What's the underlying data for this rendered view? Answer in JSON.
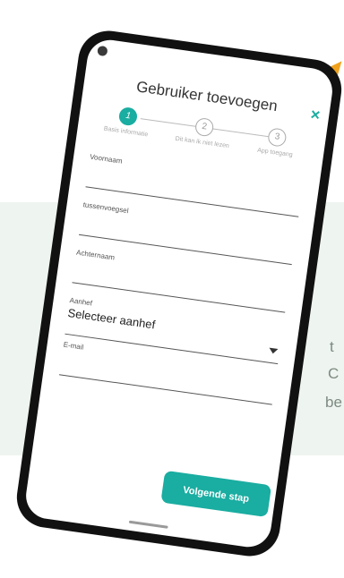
{
  "background": {
    "peek_texts": [
      "t",
      "C",
      "be"
    ]
  },
  "dialog": {
    "title": "Gebruiker toevoegen",
    "close_label": "×",
    "steps": [
      {
        "number": "1",
        "label": "Basis informatie",
        "active": true
      },
      {
        "number": "2",
        "label": "Dit kan ik niet lezen",
        "active": false
      },
      {
        "number": "3",
        "label": "App toegang",
        "active": false
      }
    ],
    "fields": {
      "first_name": {
        "label": "Voornaam",
        "value": ""
      },
      "infix": {
        "label": "tussenvoegsel",
        "value": ""
      },
      "last_name": {
        "label": "Achternaam",
        "value": ""
      },
      "salutation": {
        "label": "Aanhef",
        "value": "Selecteer aanhef"
      },
      "email": {
        "label": "E-mail",
        "value": ""
      }
    },
    "next_button": "Volgende stap"
  },
  "colors": {
    "accent": "#1aada1",
    "band": "#eef4ef",
    "arrow": "#f0a21e"
  }
}
